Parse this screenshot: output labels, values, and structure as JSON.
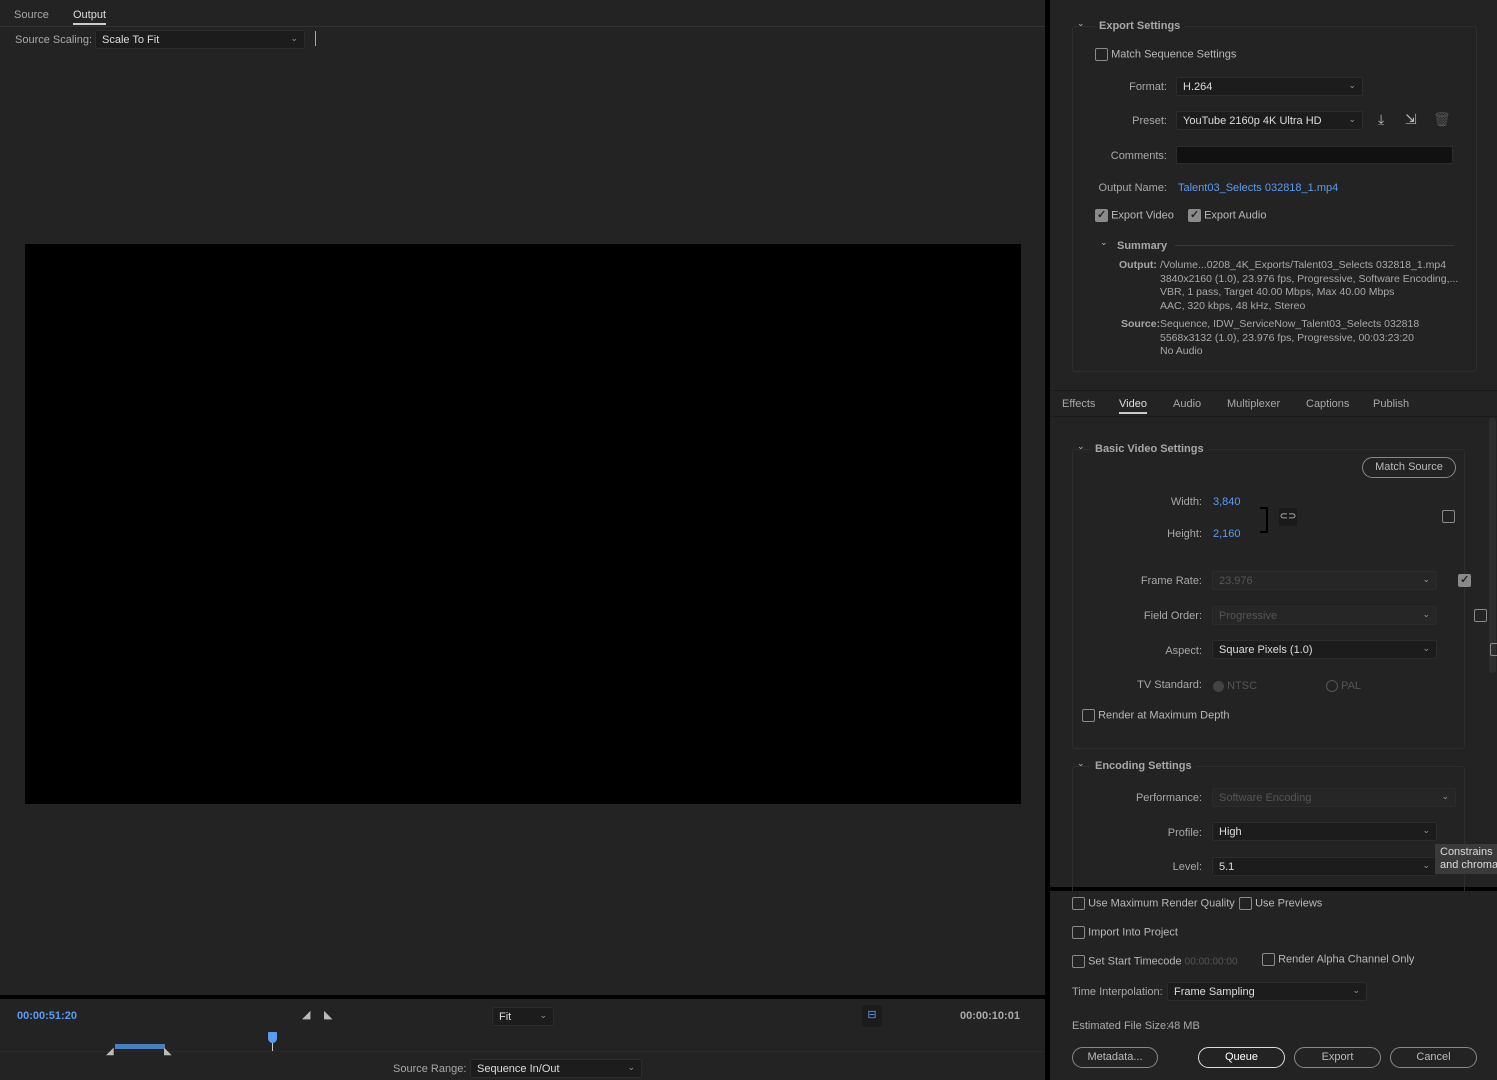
{
  "left": {
    "tabs": [
      "Source",
      "Output"
    ],
    "active_tab": "Output",
    "source_scaling_label": "Source Scaling:",
    "source_scaling_value": "Scale To Fit"
  },
  "timeline": {
    "current_time": "00:00:51:20",
    "zoom": "Fit",
    "duration": "00:00:10:01",
    "source_range_label": "Source Range:",
    "source_range_value": "Sequence In/Out"
  },
  "export_settings": {
    "title": "Export Settings",
    "match_sequence": "Match Sequence Settings",
    "format_label": "Format:",
    "format": "H.264",
    "preset_label": "Preset:",
    "preset": "YouTube 2160p 4K Ultra HD",
    "comments_label": "Comments:",
    "comments": "",
    "output_name_label": "Output Name:",
    "output_name": "Talent03_Selects 032818_1.mp4",
    "export_video": "Export Video",
    "export_audio": "Export Audio",
    "summary": {
      "title": "Summary",
      "output_label": "Output:",
      "output_lines": [
        "/Volume...0208_4K_Exports/Talent03_Selects 032818_1.mp4",
        "3840x2160 (1.0), 23.976 fps, Progressive, Software Encoding,...",
        "VBR, 1 pass, Target 40.00 Mbps, Max 40.00 Mbps",
        "AAC, 320 kbps, 48 kHz, Stereo"
      ],
      "source_label": "Source:",
      "source_lines": [
        "Sequence, IDW_ServiceNow_Talent03_Selects 032818",
        "5568x3132 (1.0), 23.976 fps, Progressive, 00:03:23:20",
        "No Audio"
      ]
    }
  },
  "settings_tabs": [
    "Effects",
    "Video",
    "Audio",
    "Multiplexer",
    "Captions",
    "Publish"
  ],
  "active_settings_tab": "Video",
  "basic_video": {
    "title": "Basic Video Settings",
    "match_source": "Match Source",
    "width_label": "Width:",
    "width": "3,840",
    "height_label": "Height:",
    "height": "2,160",
    "frame_rate_label": "Frame Rate:",
    "frame_rate": "23.976",
    "field_order_label": "Field Order:",
    "field_order": "Progressive",
    "aspect_label": "Aspect:",
    "aspect": "Square Pixels (1.0)",
    "tv_standard_label": "TV Standard:",
    "ntsc": "NTSC",
    "pal": "PAL",
    "render_max_depth": "Render at Maximum Depth"
  },
  "encoding": {
    "title": "Encoding Settings",
    "performance_label": "Performance:",
    "performance": "Software Encoding",
    "profile_label": "Profile:",
    "profile": "High",
    "level_label": "Level:",
    "level": "5.1",
    "tooltip_lines": [
      "Constrains",
      "and chroma"
    ]
  },
  "bottom": {
    "max_render_quality": "Use Maximum Render Quality",
    "use_previews": "Use Previews",
    "import_project": "Import Into Project",
    "set_start_tc": "Set Start Timecode",
    "start_tc": "00:00:00:00",
    "alpha_only": "Render Alpha Channel Only",
    "time_interp_label": "Time Interpolation:",
    "time_interp": "Frame Sampling",
    "file_size_label": "Estimated File Size:",
    "file_size": "48 MB",
    "metadata": "Metadata...",
    "queue": "Queue",
    "export": "Export",
    "cancel": "Cancel"
  },
  "colors": {
    "accent": "#5b9cf0",
    "panel": "#232323"
  }
}
